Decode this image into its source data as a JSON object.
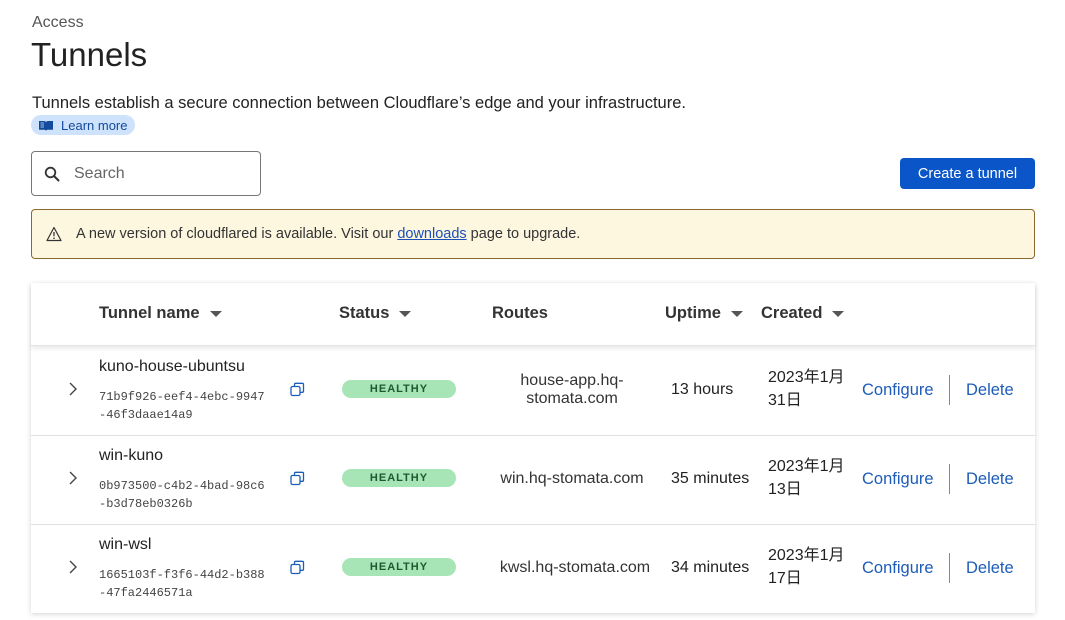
{
  "breadcrumb": "Access",
  "page_title": "Tunnels",
  "description": "Tunnels establish a secure connection between Cloudflare’s edge and your infrastructure.",
  "learn_more": {
    "label": "Learn more",
    "icon": "book-icon"
  },
  "search": {
    "placeholder": "Search",
    "value": ""
  },
  "create_button": "Create a tunnel",
  "alert": {
    "prefix": "A new version of cloudflared is available. Visit our ",
    "link": "downloads",
    "suffix": " page to upgrade."
  },
  "table": {
    "columns": {
      "name": "Tunnel name",
      "status": "Status",
      "routes": "Routes",
      "uptime": "Uptime",
      "created": "Created"
    },
    "rows": [
      {
        "name": "kuno-house-ubuntsu",
        "id": "71b9f926-eef4-4ebc-9947-46f3daae14a9",
        "status": "HEALTHY",
        "route": "house-app.hq-stomata.com",
        "uptime": "13 hours",
        "created": "2023年1月31日",
        "configure": "Configure",
        "delete": "Delete"
      },
      {
        "name": "win-kuno",
        "id": "0b973500-c4b2-4bad-98c6-b3d78eb0326b",
        "status": "HEALTHY",
        "route": "win.hq-stomata.com",
        "uptime": "35 minutes",
        "created": "2023年1月13日",
        "configure": "Configure",
        "delete": "Delete"
      },
      {
        "name": "win-wsl",
        "id": "1665103f-f3f6-44d2-b388-47fa2446571a",
        "status": "HEALTHY",
        "route": "kwsl.hq-stomata.com",
        "uptime": "34 minutes",
        "created": "2023年1月17日",
        "configure": "Configure",
        "delete": "Delete"
      }
    ]
  },
  "colors": {
    "primary": "#0a55c7",
    "link": "#1d5cb8",
    "healthy_bg": "#a7e5b6",
    "alert_bg": "#fdf7e0"
  }
}
